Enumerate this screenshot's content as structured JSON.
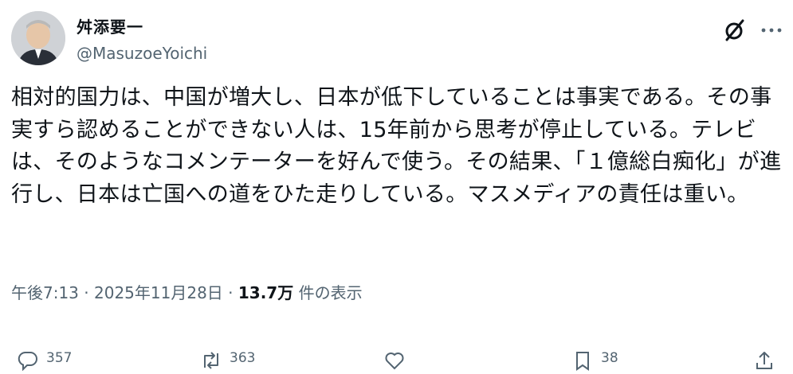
{
  "author": {
    "display_name": "舛添要一",
    "handle": "@MasuzoeYoichi"
  },
  "tweet": {
    "text": "相対的国力は、中国が増大し、日本が低下していることは事実である。その事実すら認めることができない人は、15年前から思考が停止している。テレビは、そのようなコメンテーターを好んで使う。その結果、「１億総白痴化」が進行し、日本は亡国への道をひた走りしている。マスメディアの責任は重い。"
  },
  "meta": {
    "time": "午後7:13",
    "separator1": " · ",
    "date": "2025年11月28日",
    "separator2": " · ",
    "views_count": "13.7万",
    "views_label": " 件の表示"
  },
  "actions": {
    "replies": "357",
    "reposts": "363",
    "bookmarks": "38"
  },
  "icons": {
    "grok": "grok-icon",
    "more": "more-dots-icon",
    "reply": "reply-icon",
    "repost": "repost-icon",
    "like": "like-icon",
    "bookmark": "bookmark-icon",
    "share": "share-icon"
  },
  "colors": {
    "text": "#0f1419",
    "secondary": "#536471"
  }
}
